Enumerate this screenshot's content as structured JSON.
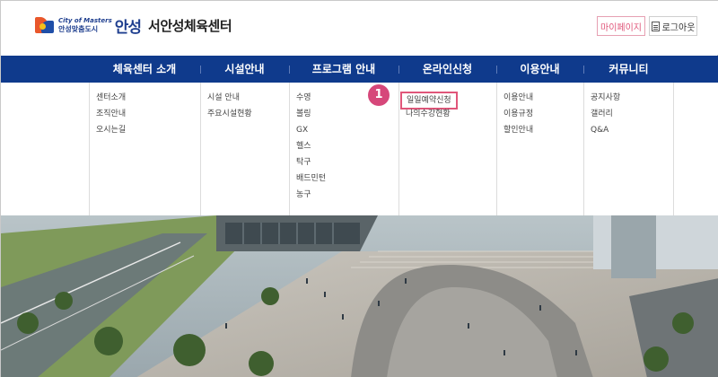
{
  "header": {
    "logo_en": "City of Masters",
    "logo_ko": "안성맞춤도시",
    "city_name": "안성",
    "center_name": "서안성체육센터",
    "mypage_label": "마이페이지",
    "logout_label": "로그아웃"
  },
  "nav": {
    "items": [
      "체육센터 소개",
      "시설안내",
      "프로그램 안내",
      "온라인신청",
      "이용안내",
      "커뮤니티"
    ]
  },
  "dropdown": {
    "col0": [
      "센터소개",
      "조직안내",
      "오시는길"
    ],
    "col1": [
      "시설 안내",
      "주요시설현황"
    ],
    "col2": [
      "수영",
      "볼링",
      "GX",
      "헬스",
      "탁구",
      "배드민턴",
      "농구"
    ],
    "col3": [
      "일일예약신청",
      "나의수강현황"
    ],
    "col4": [
      "이용안내",
      "이용규정",
      "할인안내"
    ],
    "col5": [
      "공지사항",
      "갤러리",
      "Q&A"
    ]
  },
  "marker": "1",
  "colors": {
    "nav_bg": "#0f3a8c",
    "highlight": "#e0567a",
    "marker": "#d6477a"
  }
}
